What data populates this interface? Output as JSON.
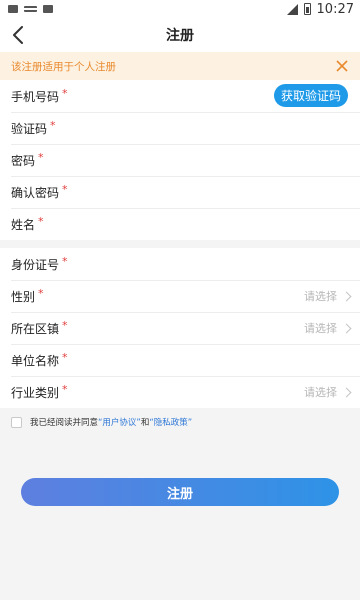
{
  "status_bar": {
    "time": "10:27"
  },
  "nav": {
    "title": "注册"
  },
  "notice": {
    "text": "该注册适用于个人注册"
  },
  "form": {
    "required_mark": "*",
    "phone_label": "手机号码",
    "get_code_label": "获取验证码",
    "code_label": "验证码",
    "password_label": "密码",
    "confirm_password_label": "确认密码",
    "name_label": "姓名",
    "id_label": "身份证号",
    "gender_label": "性别",
    "gender_placeholder": "请选择",
    "district_label": "所在区镇",
    "district_placeholder": "请选择",
    "org_label": "单位名称",
    "industry_label": "行业类别",
    "industry_placeholder": "请选择"
  },
  "agreement": {
    "prefix": "我已经阅读并同意",
    "user_agreement": "“用户协议”",
    "and": "和",
    "privacy_policy": "“隐私政策”"
  },
  "submit_label": "注册",
  "colors": {
    "accent": "#1e9ae8",
    "notice_bg": "#fdf1e2",
    "notice_text": "#e98a2d",
    "required": "#e23b3b",
    "link": "#2f78d6"
  }
}
